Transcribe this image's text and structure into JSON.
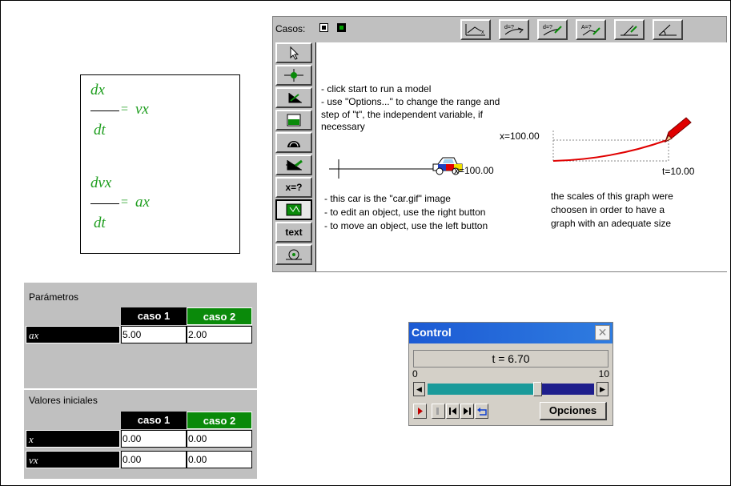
{
  "equations": [
    {
      "numerator": "dx",
      "rhs": "vx",
      "denominator": "dt"
    },
    {
      "numerator": "dvx",
      "rhs": "ax",
      "denominator": "dt"
    }
  ],
  "model": {
    "casos_label": "Casos:",
    "palette_text_labels": {
      "xeq": "x=?",
      "text": "text"
    },
    "instructions": [
      "- click start to run a model",
      "- use \"Options...\" to change the range and",
      "step of \"t\", the independent variable, if",
      "necessary"
    ],
    "car_label": "x=100.00",
    "graph_x_label": "x=100.00",
    "graph_t_label": "t=10.00",
    "car_notes": [
      "- this car is the \"car.gif\" image",
      "- to edit an object, use the right button",
      "- to move an object, use the left button"
    ],
    "graph_notes": [
      "the scales of this graph were",
      "choosen in order to have a",
      "graph with an adequate size"
    ]
  },
  "parameters": {
    "title": "Parámetros",
    "case1": "caso 1",
    "case2": "caso 2",
    "rows": [
      {
        "name": "ax",
        "c1": "5.00",
        "c2": "2.00"
      }
    ]
  },
  "initial_values": {
    "title": "Valores iniciales",
    "case1": "caso 1",
    "case2": "caso 2",
    "rows": [
      {
        "name": "x",
        "c1": "0.00",
        "c2": "0.00"
      },
      {
        "name": "vx",
        "c1": "0.00",
        "c2": "0.00"
      }
    ]
  },
  "control": {
    "title": "Control",
    "close": "✕",
    "time_display": "t =  6.70",
    "slider_min": "0",
    "slider_max": "10",
    "slider_value_fraction": 0.67,
    "options_label": "Opciones"
  },
  "colors": {
    "equation_green": "#1f9e1f",
    "case2_green": "#0a8a0a",
    "control_title_blue": "#1c5ad4",
    "graph_red": "#e00000"
  }
}
